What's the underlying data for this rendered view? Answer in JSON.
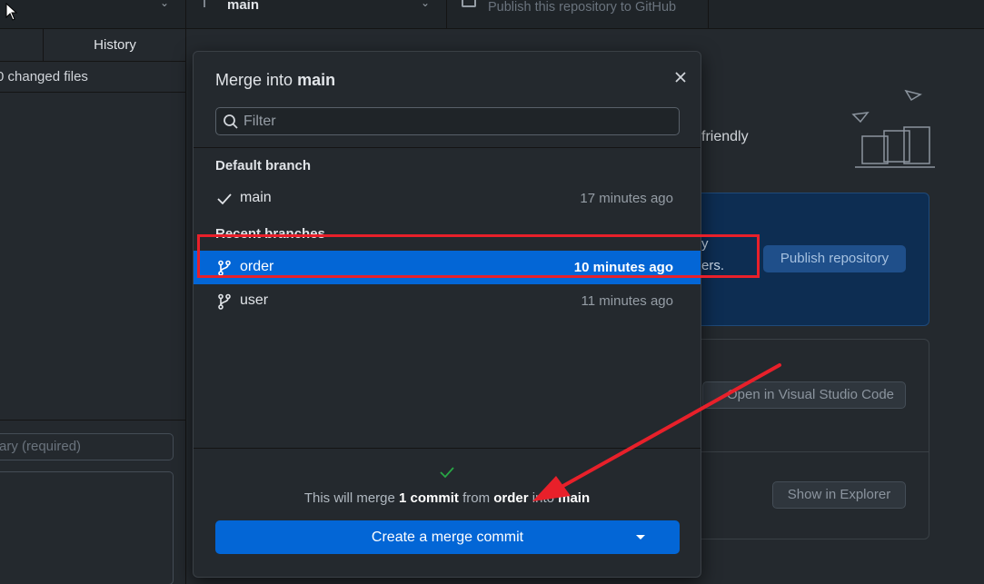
{
  "toolbar": {
    "current_branch_label": "main",
    "publish_label": "Publish this repository to GitHub"
  },
  "sidebar": {
    "tab_history": "History",
    "changed_files": "0 changed files",
    "summary_placeholder": "ary (required)"
  },
  "main": {
    "friendly_text": "friendly",
    "blue_card_line1": "y",
    "blue_card_line2": "ers.",
    "publish_button": "Publish repository",
    "vscode_button": "Open in Visual Studio Code",
    "explorer_button": "Show in Explorer"
  },
  "modal": {
    "title_prefix": "Merge into",
    "title_branch": "main",
    "filter_placeholder": "Filter",
    "default_branch_header": "Default branch",
    "recent_branches_header": "Recent branches",
    "default_branch": {
      "name": "main",
      "time": "17 minutes ago"
    },
    "recent_branches": [
      {
        "name": "order",
        "time": "10 minutes ago",
        "selected": true
      },
      {
        "name": "user",
        "time": "11 minutes ago",
        "selected": false
      }
    ],
    "merge_msg": {
      "prefix": "This will merge",
      "count": "1 commit",
      "from_word": "from",
      "source": "order",
      "into_word": "into",
      "target": "main"
    },
    "merge_button": "Create a merge commit"
  },
  "colors": {
    "accent": "#0366d6",
    "annotation": "#e8202a",
    "success": "#28a745",
    "background": "#24292e"
  },
  "icons": {
    "close": "close-icon",
    "search": "search-icon",
    "check": "check-icon",
    "branch": "git-branch-icon",
    "caret": "caret-down-icon"
  }
}
